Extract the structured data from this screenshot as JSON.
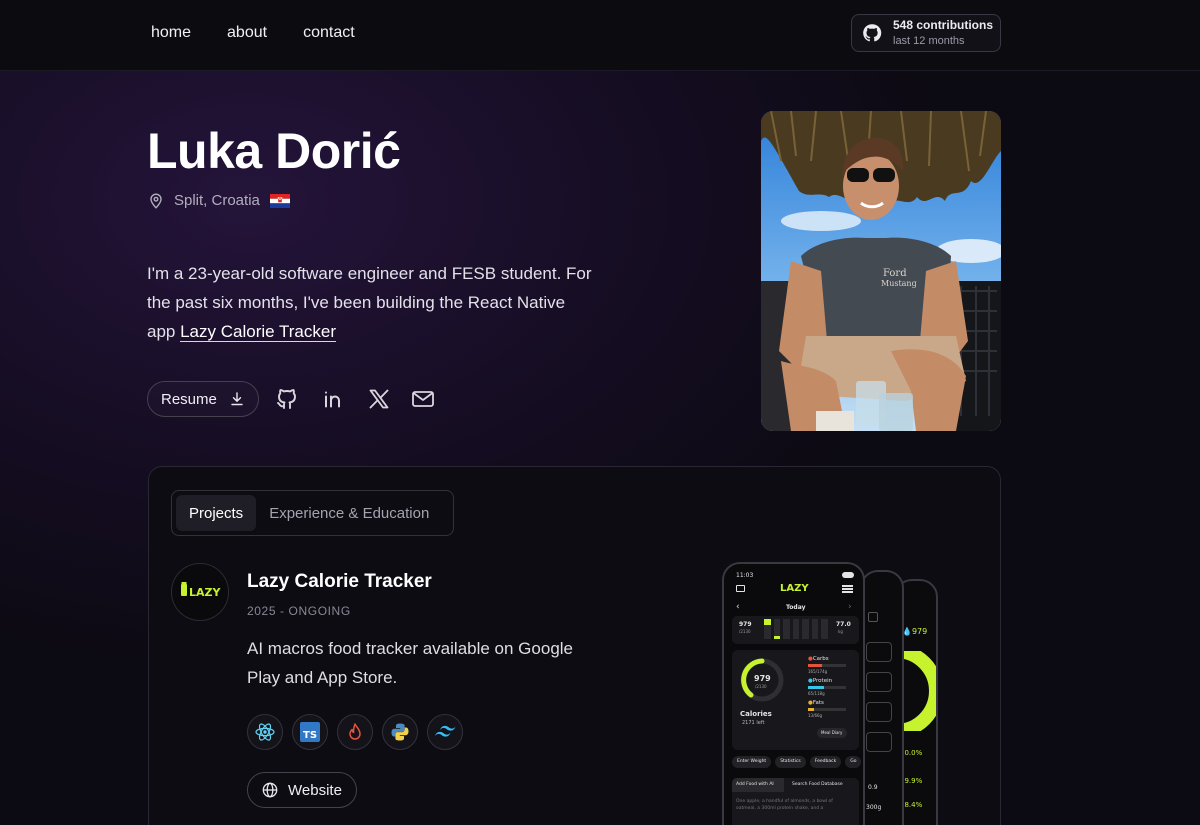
{
  "nav": {
    "links": [
      "home",
      "about",
      "contact"
    ],
    "contributions": {
      "count": "548 contributions",
      "period": "last 12 months"
    }
  },
  "hero": {
    "name": "Luka Dorić",
    "location": "Split, Croatia",
    "bio_text": "I'm a 23-year-old software engineer and FESB student. For the past six months, I've been building the React Native app ",
    "bio_link": "Lazy Calorie Tracker",
    "resume_label": "Resume",
    "icons": {
      "location": "map-pin-icon",
      "flag": "croatia-flag-icon",
      "download": "download-icon",
      "socials": [
        "github-icon",
        "linkedin-icon",
        "x-icon",
        "mail-icon"
      ]
    }
  },
  "tabs": [
    {
      "label": "Projects",
      "active": true
    },
    {
      "label": "Experience & Education",
      "active": false
    }
  ],
  "project": {
    "logo_text": "LAZY",
    "title": "Lazy Calorie Tracker",
    "date": "2025 - ONGOING",
    "description": "AI macros food tracker available on Google Play and App Store.",
    "tech_icons": [
      "react-icon",
      "typescript-icon",
      "firebase-icon",
      "python-icon",
      "tailwind-icon"
    ],
    "website_label": "Website",
    "phone": {
      "time": "11:03",
      "brand": "LAZY",
      "day": "Today",
      "cal_consumed": "979",
      "cal_goal": "/2130",
      "weight": "77.0",
      "weight_unit": "kg",
      "ring_value": "979",
      "ring_goal": "/2130",
      "ring_label": "Calories",
      "ring_left": "2171 left",
      "macros": [
        {
          "name": "Carbs",
          "value": "165",
          "goal": "/174g",
          "color": "#e5533d"
        },
        {
          "name": "Protein",
          "value": "65",
          "goal": "/118g",
          "color": "#35c5e6"
        },
        {
          "name": "Fats",
          "value": "13",
          "goal": "/66g",
          "color": "#e8b030"
        }
      ],
      "meal_diary": "Meal Diary",
      "chips": [
        "Enter Weight",
        "Statistics",
        "Feedback",
        "Go"
      ],
      "add_food": "Add Food with AI",
      "search_food": "Search Food Database",
      "hint": "One apple, a handful of almonds, a bowl of oatmeal, a 300ml protein shake, and a",
      "side_cal": "979",
      "percents": [
        "30.0%",
        "19.9%",
        "18.4%"
      ],
      "side_small": [
        "0.9",
        "300g"
      ]
    }
  },
  "colors": {
    "accent_green": "#c6f32e",
    "background": "#0c0a12",
    "purple_glow": "#24143a"
  }
}
